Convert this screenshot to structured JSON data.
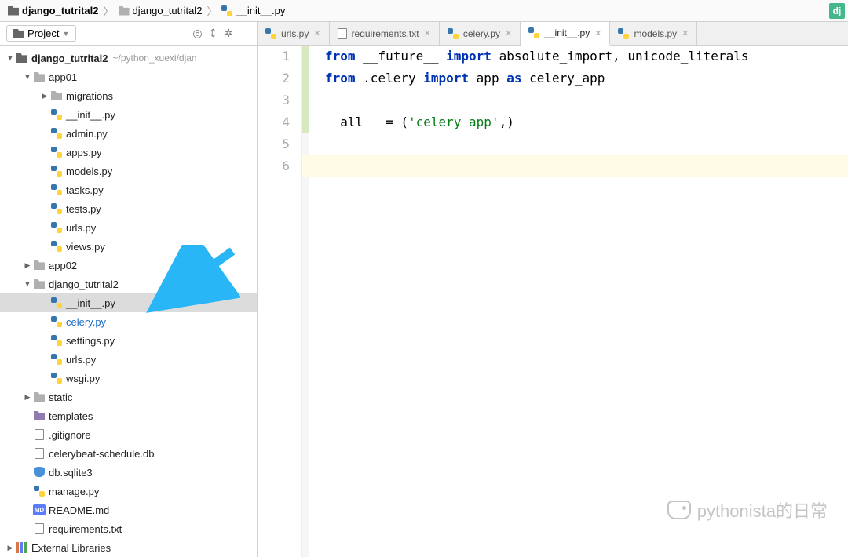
{
  "breadcrumb": [
    {
      "icon": "folder-dark",
      "label": "django_tutrital2",
      "bold": true
    },
    {
      "icon": "folder-gray",
      "label": "django_tutrital2"
    },
    {
      "icon": "py",
      "label": "__init__.py"
    }
  ],
  "dj_badge": "dj",
  "sidebar": {
    "dropdown_label": "Project",
    "tool_icons": [
      "target-icon",
      "collapse-icon",
      "gear-icon",
      "minimize-icon"
    ]
  },
  "tree": [
    {
      "depth": 0,
      "arrow": "down",
      "icon": "folder-dark",
      "label": "django_tutrital2",
      "bold": true,
      "path": "~/python_xuexi/djan"
    },
    {
      "depth": 1,
      "arrow": "down",
      "icon": "folder-gray",
      "label": "app01"
    },
    {
      "depth": 2,
      "arrow": "right",
      "icon": "folder-gray",
      "label": "migrations"
    },
    {
      "depth": 2,
      "arrow": "none",
      "icon": "py",
      "label": "__init__.py"
    },
    {
      "depth": 2,
      "arrow": "none",
      "icon": "py",
      "label": "admin.py"
    },
    {
      "depth": 2,
      "arrow": "none",
      "icon": "py",
      "label": "apps.py"
    },
    {
      "depth": 2,
      "arrow": "none",
      "icon": "py",
      "label": "models.py"
    },
    {
      "depth": 2,
      "arrow": "none",
      "icon": "py",
      "label": "tasks.py"
    },
    {
      "depth": 2,
      "arrow": "none",
      "icon": "py",
      "label": "tests.py"
    },
    {
      "depth": 2,
      "arrow": "none",
      "icon": "py",
      "label": "urls.py"
    },
    {
      "depth": 2,
      "arrow": "none",
      "icon": "py",
      "label": "views.py"
    },
    {
      "depth": 1,
      "arrow": "right",
      "icon": "folder-gray",
      "label": "app02"
    },
    {
      "depth": 1,
      "arrow": "down",
      "icon": "folder-gray",
      "label": "django_tutrital2"
    },
    {
      "depth": 2,
      "arrow": "none",
      "icon": "py",
      "label": "__init__.py",
      "selected": true
    },
    {
      "depth": 2,
      "arrow": "none",
      "icon": "py",
      "label": "celery.py",
      "link": true
    },
    {
      "depth": 2,
      "arrow": "none",
      "icon": "py",
      "label": "settings.py"
    },
    {
      "depth": 2,
      "arrow": "none",
      "icon": "py",
      "label": "urls.py"
    },
    {
      "depth": 2,
      "arrow": "none",
      "icon": "py",
      "label": "wsgi.py"
    },
    {
      "depth": 1,
      "arrow": "right",
      "icon": "folder-gray",
      "label": "static"
    },
    {
      "depth": 1,
      "arrow": "none",
      "icon": "folder-purple",
      "label": "templates"
    },
    {
      "depth": 1,
      "arrow": "none",
      "icon": "file",
      "label": ".gitignore"
    },
    {
      "depth": 1,
      "arrow": "none",
      "icon": "file",
      "label": "celerybeat-schedule.db"
    },
    {
      "depth": 1,
      "arrow": "none",
      "icon": "db",
      "label": "db.sqlite3"
    },
    {
      "depth": 1,
      "arrow": "none",
      "icon": "py",
      "label": "manage.py"
    },
    {
      "depth": 1,
      "arrow": "none",
      "icon": "md",
      "label": "README.md"
    },
    {
      "depth": 1,
      "arrow": "none",
      "icon": "file",
      "label": "requirements.txt"
    },
    {
      "depth": 0,
      "arrow": "right",
      "icon": "lib",
      "label": "External Libraries"
    }
  ],
  "tabs": [
    {
      "icon": "py",
      "label": "urls.py",
      "active": false
    },
    {
      "icon": "file",
      "label": "requirements.txt",
      "active": false
    },
    {
      "icon": "py",
      "label": "celery.py",
      "active": false
    },
    {
      "icon": "py",
      "label": "__init__.py",
      "active": true
    },
    {
      "icon": "py",
      "label": "models.py",
      "active": false
    }
  ],
  "code": {
    "lines": [
      {
        "tokens": [
          {
            "t": "from ",
            "c": "kw"
          },
          {
            "t": "__future__ "
          },
          {
            "t": "import ",
            "c": "kw"
          },
          {
            "t": "absolute_import, unicode_literals"
          }
        ]
      },
      {
        "tokens": [
          {
            "t": "from ",
            "c": "kw"
          },
          {
            "t": ".celery "
          },
          {
            "t": "import ",
            "c": "kw"
          },
          {
            "t": "app "
          },
          {
            "t": "as ",
            "c": "kw"
          },
          {
            "t": "celery_app"
          }
        ]
      },
      {
        "tokens": []
      },
      {
        "tokens": [
          {
            "t": "__all__ = ("
          },
          {
            "t": "'celery_app'",
            "c": "str"
          },
          {
            "t": ",)"
          }
        ]
      },
      {
        "tokens": []
      },
      {
        "tokens": [],
        "current": true
      }
    ]
  },
  "watermark": "pythonista的日常"
}
